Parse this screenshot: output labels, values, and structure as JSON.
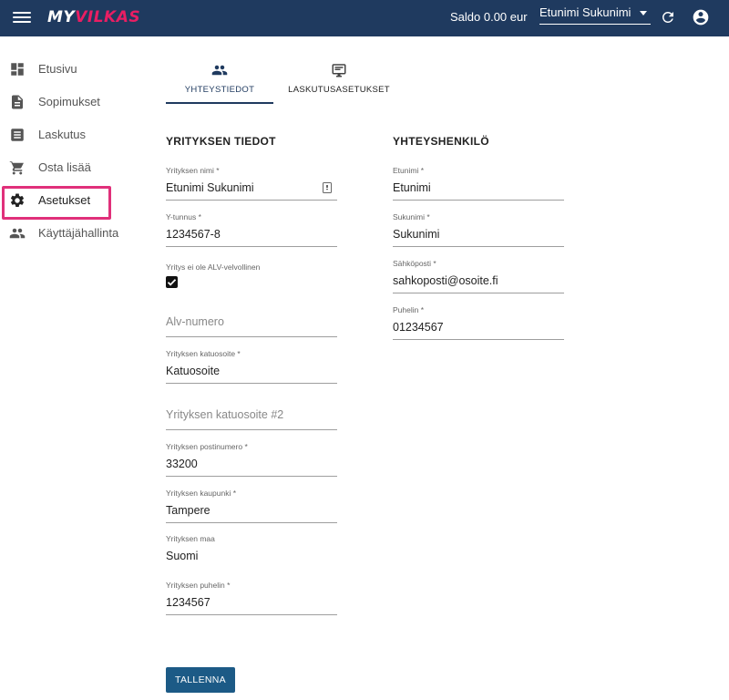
{
  "header": {
    "logo_part1": "MY",
    "logo_part2": "VILKAS",
    "balance": "Saldo 0.00 eur",
    "user_name": "Etunimi Sukunimi"
  },
  "sidebar": {
    "items": [
      {
        "label": "Etusivu",
        "icon": "dashboard-icon"
      },
      {
        "label": "Sopimukset",
        "icon": "document-icon"
      },
      {
        "label": "Laskutus",
        "icon": "invoice-icon"
      },
      {
        "label": "Osta lisää",
        "icon": "cart-icon"
      },
      {
        "label": "Asetukset",
        "icon": "gear-icon"
      },
      {
        "label": "Käyttäjähallinta",
        "icon": "users-icon"
      }
    ],
    "active_index": 4
  },
  "tabs": [
    {
      "label": "YHTEYSTIEDOT",
      "icon": "people-icon"
    },
    {
      "label": "LASKUTUSASETUKSET",
      "icon": "monitor-icon"
    }
  ],
  "company": {
    "title": "YRITYKSEN TIEDOT",
    "name_label": "Yrityksen nimi *",
    "name_value": "Etunimi Sukunimi",
    "ytunnus_label": "Y-tunnus *",
    "ytunnus_value": "1234567-8",
    "alv_check_label": "Yritys ei ole ALV-velvollinen",
    "alv_checked": true,
    "alv_number_placeholder": "Alv-numero",
    "street_label": "Yrityksen katuosoite *",
    "street_value": "Katuosoite",
    "street2_placeholder": "Yrityksen katuosoite #2",
    "postal_label": "Yrityksen postinumero *",
    "postal_value": "33200",
    "city_label": "Yrityksen kaupunki *",
    "city_value": "Tampere",
    "country_label": "Yrityksen maa",
    "country_value": "Suomi",
    "phone_label": "Yrityksen puhelin *",
    "phone_value": "1234567"
  },
  "contact": {
    "title": "YHTEYSHENKILÖ",
    "first_label": "Etunimi *",
    "first_value": "Etunimi",
    "last_label": "Sukunimi *",
    "last_value": "Sukunimi",
    "email_label": "Sähköposti *",
    "email_value": "sahkoposti@osoite.fi",
    "phone_label": "Puhelin *",
    "phone_value": "01234567"
  },
  "actions": {
    "save_label": "TALLENNA"
  },
  "colors": {
    "header_bg": "#1f3a5f",
    "accent": "#e91e63",
    "highlight": "#e0307a",
    "button": "#1c5a86"
  }
}
